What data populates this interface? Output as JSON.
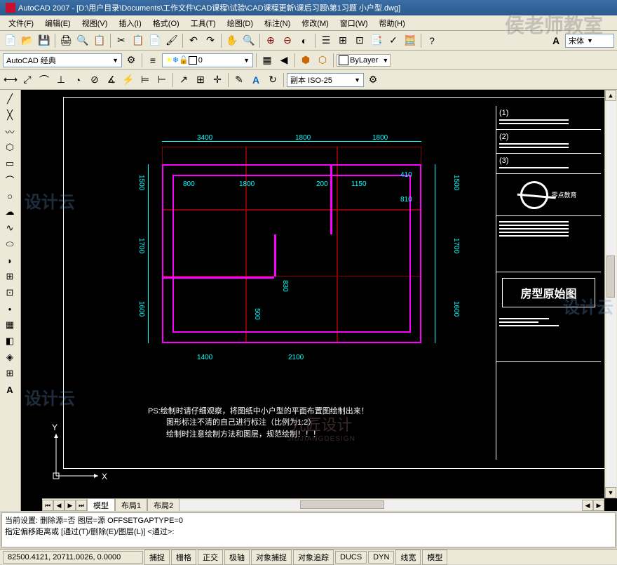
{
  "title": "AutoCAD 2007 - [D:\\用户目录\\Documents\\工作文件\\CAD课程\\试验\\CAD课程更新\\课后习题\\第1习题 小户型.dwg]",
  "menu": [
    {
      "label": "文件(F)"
    },
    {
      "label": "编辑(E)"
    },
    {
      "label": "视图(V)"
    },
    {
      "label": "插入(I)"
    },
    {
      "label": "格式(O)"
    },
    {
      "label": "工具(T)"
    },
    {
      "label": "绘图(D)"
    },
    {
      "label": "标注(N)"
    },
    {
      "label": "修改(M)"
    },
    {
      "label": "窗口(W)"
    },
    {
      "label": "帮助(H)"
    }
  ],
  "workspace": {
    "label": "AutoCAD 经典"
  },
  "layer_combo": {
    "label": "0"
  },
  "dim_style": {
    "label": "副本 ISO-25"
  },
  "bylayer": {
    "label": "ByLayer"
  },
  "font_combo": {
    "label": "宋体"
  },
  "tabs": [
    {
      "label": "模型",
      "active": true
    },
    {
      "label": "布局1"
    },
    {
      "label": "布局2"
    }
  ],
  "cmdline": {
    "line1": "当前设置: 删除源=否  图层=源  OFFSETGAPTYPE=0",
    "line2": "指定偏移距离或 [通过(T)/删除(E)/图层(L)] <通过>:"
  },
  "statusbar": {
    "coords": "82500.4121, 20711.0026, 0.0000",
    "items": [
      "捕捉",
      "栅格",
      "正交",
      "极轴",
      "对象捕捉",
      "对象追踪",
      "DUCS",
      "DYN",
      "线宽",
      "模型"
    ]
  },
  "dimensions": {
    "top": [
      "3400",
      "1800",
      "1800"
    ],
    "left": [
      "1500",
      "1700",
      "1600"
    ],
    "right": [
      "1500",
      "1700",
      "1600"
    ],
    "inner": [
      "800",
      "1800",
      "200",
      "1150",
      "410",
      "810",
      "1400",
      "2100",
      "500",
      "830"
    ]
  },
  "notes": {
    "line1": "PS:绘制时请仔细观察，将图纸中小户型的平面布置图绘制出来！",
    "line2": "图形标注不清的自己进行标注（比例为1:2）",
    "line3": "绘制时注意绘制方法和图层，规范绘制！！！"
  },
  "title_block": {
    "items": [
      "(1)",
      "(2)",
      "(3)"
    ],
    "logo_text": "零点教育",
    "main_title": "房型原始图"
  },
  "ucs": {
    "x": "X",
    "y": "Y"
  },
  "watermark_text": "设计云",
  "big_watermark": "侯老师教室",
  "center_wm1": "九匠设计",
  "center_wm2": "JIUJIANGDESIGN"
}
